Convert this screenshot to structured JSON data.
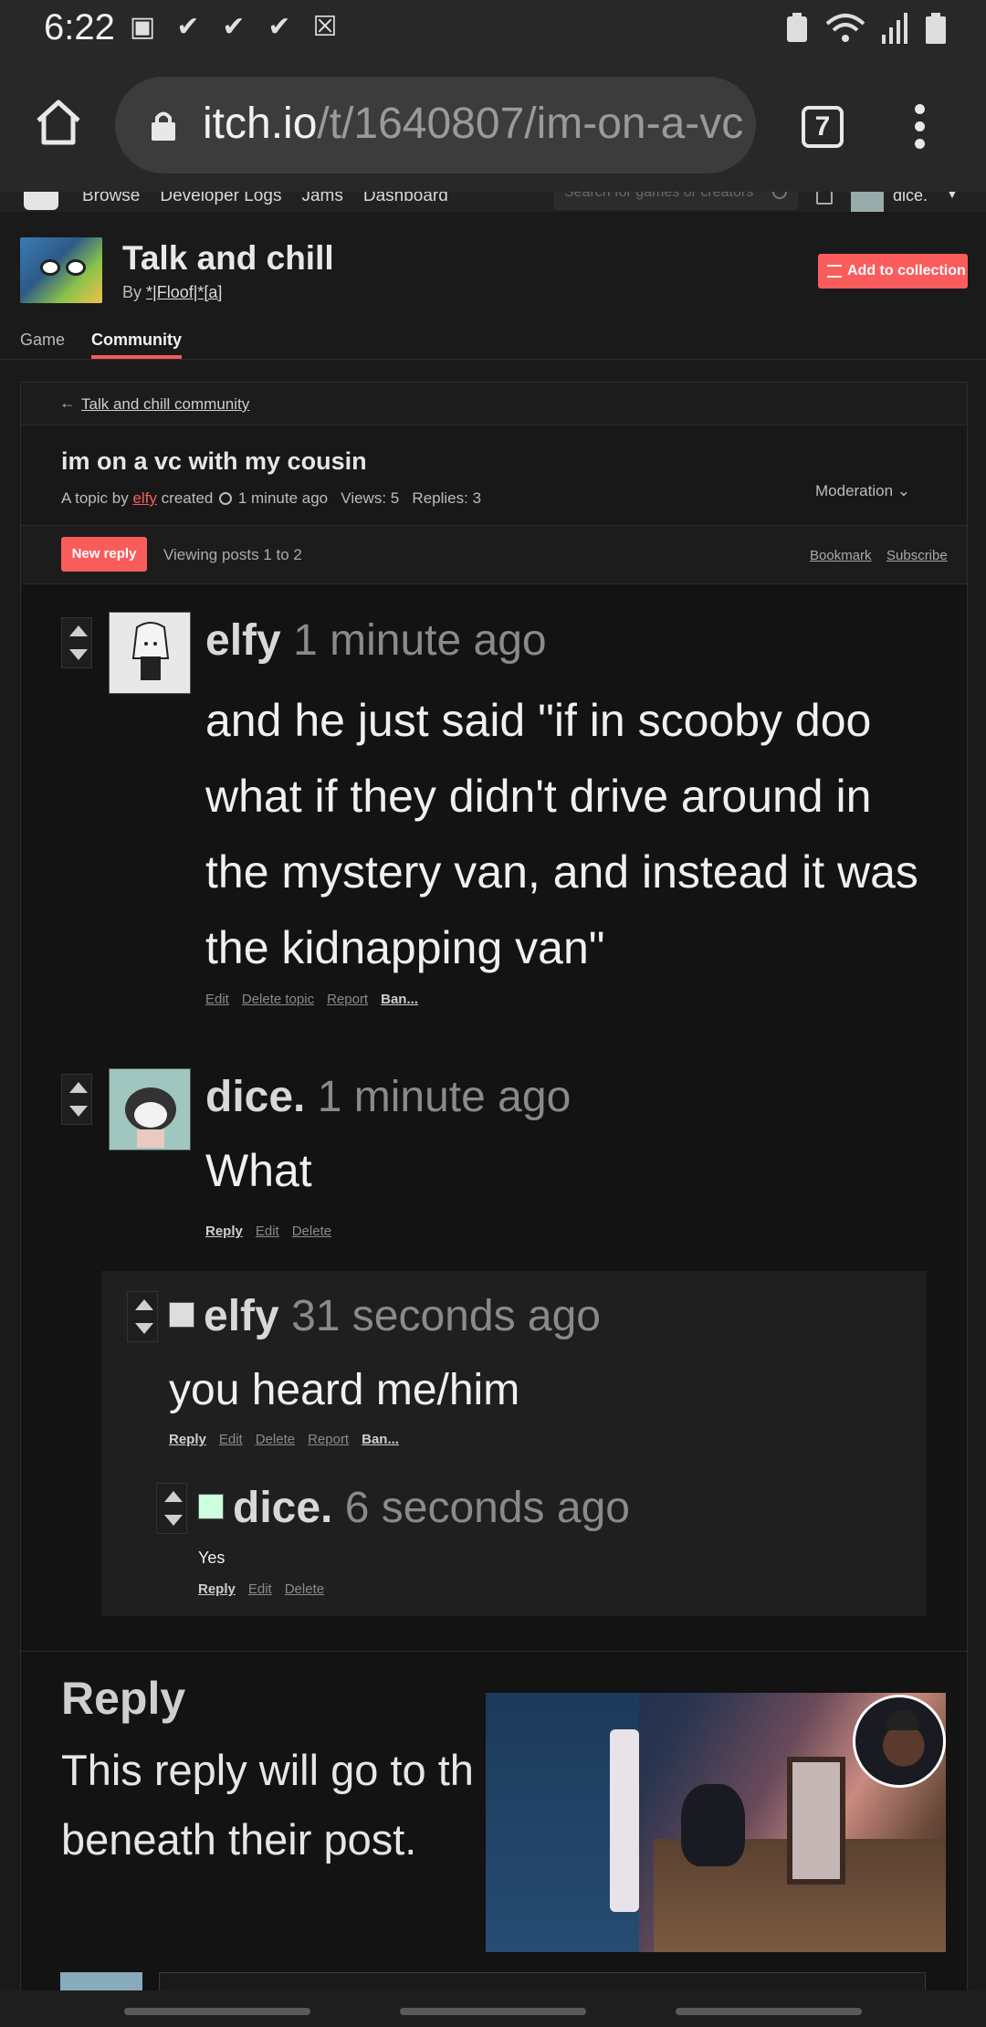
{
  "status_bar": {
    "time": "6:22"
  },
  "browser": {
    "url_host": "itch.io",
    "url_path": "/t/1640807/im-on-a-vc",
    "tab_count": "7"
  },
  "itch_nav": {
    "links": [
      "Browse",
      "Developer Logs",
      "Jams",
      "Dashboard"
    ],
    "search_placeholder": "Search for games or creators",
    "username": "dice."
  },
  "game": {
    "title": "Talk and chill",
    "by_prefix": "By",
    "author": "*|Floof|*[a]",
    "add_to_collection": "Add to collection",
    "tabs": [
      "Game",
      "Community"
    ]
  },
  "community": {
    "back_link": "Talk and chill community",
    "topic_title": "im on a vc with my cousin",
    "meta_prefix": "A topic by",
    "meta_author": "elfy",
    "meta_created": "created",
    "meta_time": "1 minute ago",
    "meta_views": "Views: 5",
    "meta_replies": "Replies: 3",
    "moderation": "Moderation",
    "new_reply": "New reply",
    "viewing": "Viewing posts 1 to 2",
    "bookmark": "Bookmark",
    "subscribe": "Subscribe"
  },
  "posts": [
    {
      "author": "elfy",
      "time": "1 minute ago",
      "body": "and he just said \"if in scooby doo what if they didn't drive around in the mystery van, and instead it was the kidnapping van\"",
      "actions": [
        "Edit",
        "Delete topic",
        "Report",
        "Ban..."
      ]
    },
    {
      "author": "dice.",
      "time": "1 minute ago",
      "body": "What",
      "actions": [
        "Reply",
        "Edit",
        "Delete"
      ]
    },
    {
      "author": "elfy",
      "time": "31 seconds ago",
      "body": "you heard me/him",
      "actions": [
        "Reply",
        "Edit",
        "Delete",
        "Report",
        "Ban..."
      ]
    },
    {
      "author": "dice.",
      "time": "6 seconds ago",
      "body": "Yes",
      "actions": [
        "Reply",
        "Edit",
        "Delete"
      ]
    }
  ],
  "reply_section": {
    "title": "Reply",
    "text": "This reply will go to th Want to reply to some beneath their post."
  },
  "icons": {
    "home": "home-icon",
    "lock": "lock-icon",
    "menu": "more-vert-icon",
    "search": "search-icon",
    "bell": "bell-icon",
    "chevron": "chevron-down-icon"
  },
  "colors": {
    "accent": "#fa5c5c",
    "background": "#131313"
  }
}
